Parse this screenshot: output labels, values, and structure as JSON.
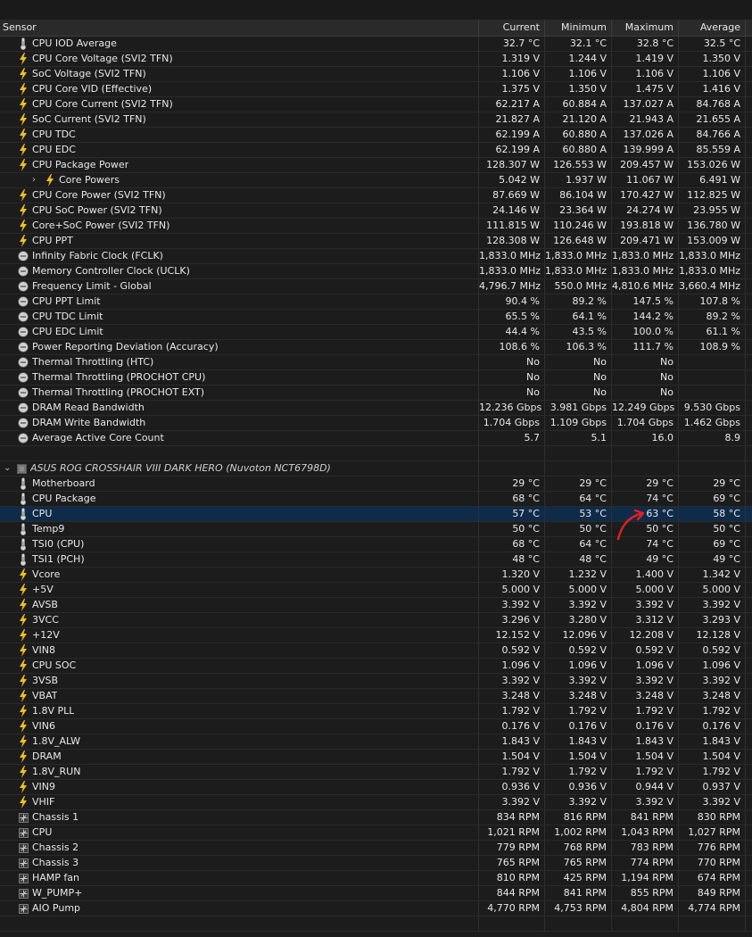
{
  "header": {
    "sensor": "Sensor",
    "current": "Current",
    "minimum": "Minimum",
    "maximum": "Maximum",
    "average": "Average"
  },
  "rows": [
    {
      "type": "sensor",
      "icon": "thermometer-icon",
      "label": "CPU IOD Average",
      "current": "32.7 °C",
      "minimum": "32.1 °C",
      "maximum": "32.8 °C",
      "average": "32.5 °C"
    },
    {
      "type": "sensor",
      "icon": "bolt-icon",
      "label": "CPU Core Voltage (SVI2 TFN)",
      "current": "1.319 V",
      "minimum": "1.244 V",
      "maximum": "1.419 V",
      "average": "1.350 V"
    },
    {
      "type": "sensor",
      "icon": "bolt-icon",
      "label": "SoC Voltage (SVI2 TFN)",
      "current": "1.106 V",
      "minimum": "1.106 V",
      "maximum": "1.106 V",
      "average": "1.106 V"
    },
    {
      "type": "sensor",
      "icon": "bolt-icon",
      "label": "CPU Core VID (Effective)",
      "current": "1.375 V",
      "minimum": "1.350 V",
      "maximum": "1.475 V",
      "average": "1.416 V"
    },
    {
      "type": "sensor",
      "icon": "bolt-icon",
      "label": "CPU Core Current (SVI2 TFN)",
      "current": "62.217 A",
      "minimum": "60.884 A",
      "maximum": "137.027 A",
      "average": "84.768 A"
    },
    {
      "type": "sensor",
      "icon": "bolt-icon",
      "label": "SoC Current (SVI2 TFN)",
      "current": "21.827 A",
      "minimum": "21.120 A",
      "maximum": "21.943 A",
      "average": "21.655 A"
    },
    {
      "type": "sensor",
      "icon": "bolt-icon",
      "label": "CPU TDC",
      "current": "62.199 A",
      "minimum": "60.880 A",
      "maximum": "137.026 A",
      "average": "84.766 A"
    },
    {
      "type": "sensor",
      "icon": "bolt-icon",
      "label": "CPU EDC",
      "current": "62.199 A",
      "minimum": "60.880 A",
      "maximum": "139.999 A",
      "average": "85.559 A"
    },
    {
      "type": "sensor",
      "icon": "bolt-icon",
      "label": "CPU Package Power",
      "current": "128.307 W",
      "minimum": "126.553 W",
      "maximum": "209.457 W",
      "average": "153.026 W"
    },
    {
      "type": "child",
      "icon": "bolt-icon",
      "label": "Core Powers",
      "current": "5.042 W",
      "minimum": "1.937 W",
      "maximum": "11.067 W",
      "average": "6.491 W"
    },
    {
      "type": "sensor",
      "icon": "bolt-icon",
      "label": "CPU Core Power (SVI2 TFN)",
      "current": "87.669 W",
      "minimum": "86.104 W",
      "maximum": "170.427 W",
      "average": "112.825 W"
    },
    {
      "type": "sensor",
      "icon": "bolt-icon",
      "label": "CPU SoC Power (SVI2 TFN)",
      "current": "24.146 W",
      "minimum": "23.364 W",
      "maximum": "24.274 W",
      "average": "23.955 W"
    },
    {
      "type": "sensor",
      "icon": "bolt-icon",
      "label": "Core+SoC Power (SVI2 TFN)",
      "current": "111.815 W",
      "minimum": "110.246 W",
      "maximum": "193.818 W",
      "average": "136.780 W"
    },
    {
      "type": "sensor",
      "icon": "bolt-icon",
      "label": "CPU PPT",
      "current": "128.308 W",
      "minimum": "126.648 W",
      "maximum": "209.471 W",
      "average": "153.009 W"
    },
    {
      "type": "sensor",
      "icon": "clock-icon",
      "label": "Infinity Fabric Clock (FCLK)",
      "current": "1,833.0 MHz",
      "minimum": "1,833.0 MHz",
      "maximum": "1,833.0 MHz",
      "average": "1,833.0 MHz"
    },
    {
      "type": "sensor",
      "icon": "clock-icon",
      "label": "Memory Controller Clock (UCLK)",
      "current": "1,833.0 MHz",
      "minimum": "1,833.0 MHz",
      "maximum": "1,833.0 MHz",
      "average": "1,833.0 MHz"
    },
    {
      "type": "sensor",
      "icon": "clock-icon",
      "label": "Frequency Limit - Global",
      "current": "4,796.7 MHz",
      "minimum": "550.0 MHz",
      "maximum": "4,810.6 MHz",
      "average": "3,660.4 MHz"
    },
    {
      "type": "sensor",
      "icon": "clock-icon",
      "label": "CPU PPT Limit",
      "current": "90.4 %",
      "minimum": "89.2 %",
      "maximum": "147.5 %",
      "average": "107.8 %"
    },
    {
      "type": "sensor",
      "icon": "clock-icon",
      "label": "CPU TDC Limit",
      "current": "65.5 %",
      "minimum": "64.1 %",
      "maximum": "144.2 %",
      "average": "89.2 %"
    },
    {
      "type": "sensor",
      "icon": "clock-icon",
      "label": "CPU EDC Limit",
      "current": "44.4 %",
      "minimum": "43.5 %",
      "maximum": "100.0 %",
      "average": "61.1 %"
    },
    {
      "type": "sensor",
      "icon": "clock-icon",
      "label": "Power Reporting Deviation (Accuracy)",
      "current": "108.6 %",
      "minimum": "106.3 %",
      "maximum": "111.7 %",
      "average": "108.9 %"
    },
    {
      "type": "sensor",
      "icon": "clock-icon",
      "label": "Thermal Throttling (HTC)",
      "current": "No",
      "minimum": "No",
      "maximum": "No",
      "average": ""
    },
    {
      "type": "sensor",
      "icon": "clock-icon",
      "label": "Thermal Throttling (PROCHOT CPU)",
      "current": "No",
      "minimum": "No",
      "maximum": "No",
      "average": ""
    },
    {
      "type": "sensor",
      "icon": "clock-icon",
      "label": "Thermal Throttling (PROCHOT EXT)",
      "current": "No",
      "minimum": "No",
      "maximum": "No",
      "average": ""
    },
    {
      "type": "sensor",
      "icon": "clock-icon",
      "label": "DRAM Read Bandwidth",
      "current": "12.236 Gbps",
      "minimum": "3.981 Gbps",
      "maximum": "12.249 Gbps",
      "average": "9.530 Gbps"
    },
    {
      "type": "sensor",
      "icon": "clock-icon",
      "label": "DRAM Write Bandwidth",
      "current": "1.704 Gbps",
      "minimum": "1.109 Gbps",
      "maximum": "1.704 Gbps",
      "average": "1.462 Gbps"
    },
    {
      "type": "sensor",
      "icon": "clock-icon",
      "label": "Average Active Core Count",
      "current": "5.7",
      "minimum": "5.1",
      "maximum": "16.0",
      "average": "8.9"
    },
    {
      "type": "blank",
      "icon": "",
      "label": "",
      "current": "",
      "minimum": "",
      "maximum": "",
      "average": ""
    },
    {
      "type": "group",
      "icon": "chip-icon",
      "label": "ASUS ROG CROSSHAIR VIII DARK HERO (Nuvoton NCT6798D)",
      "current": "",
      "minimum": "",
      "maximum": "",
      "average": ""
    },
    {
      "type": "sensor",
      "icon": "thermometer-icon",
      "label": "Motherboard",
      "current": "29 °C",
      "minimum": "29 °C",
      "maximum": "29 °C",
      "average": "29 °C"
    },
    {
      "type": "sensor",
      "icon": "thermometer-icon",
      "label": "CPU Package",
      "current": "68 °C",
      "minimum": "64 °C",
      "maximum": "74 °C",
      "average": "69 °C"
    },
    {
      "type": "sensor",
      "selected": true,
      "icon": "thermometer-icon",
      "label": "CPU",
      "current": "57 °C",
      "minimum": "53 °C",
      "maximum": "63 °C",
      "average": "58 °C"
    },
    {
      "type": "sensor",
      "icon": "thermometer-icon",
      "label": "Temp9",
      "current": "50 °C",
      "minimum": "50 °C",
      "maximum": "50 °C",
      "average": "50 °C"
    },
    {
      "type": "sensor",
      "icon": "thermometer-icon",
      "label": "TSI0 (CPU)",
      "current": "68 °C",
      "minimum": "64 °C",
      "maximum": "74 °C",
      "average": "69 °C"
    },
    {
      "type": "sensor",
      "icon": "thermometer-icon",
      "label": "TSI1 (PCH)",
      "current": "48 °C",
      "minimum": "48 °C",
      "maximum": "49 °C",
      "average": "49 °C"
    },
    {
      "type": "sensor",
      "icon": "bolt-icon",
      "label": "Vcore",
      "current": "1.320 V",
      "minimum": "1.232 V",
      "maximum": "1.400 V",
      "average": "1.342 V"
    },
    {
      "type": "sensor",
      "icon": "bolt-icon",
      "label": "+5V",
      "current": "5.000 V",
      "minimum": "5.000 V",
      "maximum": "5.000 V",
      "average": "5.000 V"
    },
    {
      "type": "sensor",
      "icon": "bolt-icon",
      "label": "AVSB",
      "current": "3.392 V",
      "minimum": "3.392 V",
      "maximum": "3.392 V",
      "average": "3.392 V"
    },
    {
      "type": "sensor",
      "icon": "bolt-icon",
      "label": "3VCC",
      "current": "3.296 V",
      "minimum": "3.280 V",
      "maximum": "3.312 V",
      "average": "3.293 V"
    },
    {
      "type": "sensor",
      "icon": "bolt-icon",
      "label": "+12V",
      "current": "12.152 V",
      "minimum": "12.096 V",
      "maximum": "12.208 V",
      "average": "12.128 V"
    },
    {
      "type": "sensor",
      "icon": "bolt-icon",
      "label": "VIN8",
      "current": "0.592 V",
      "minimum": "0.592 V",
      "maximum": "0.592 V",
      "average": "0.592 V"
    },
    {
      "type": "sensor",
      "icon": "bolt-icon",
      "label": "CPU SOC",
      "current": "1.096 V",
      "minimum": "1.096 V",
      "maximum": "1.096 V",
      "average": "1.096 V"
    },
    {
      "type": "sensor",
      "icon": "bolt-icon",
      "label": "3VSB",
      "current": "3.392 V",
      "minimum": "3.392 V",
      "maximum": "3.392 V",
      "average": "3.392 V"
    },
    {
      "type": "sensor",
      "icon": "bolt-icon",
      "label": "VBAT",
      "current": "3.248 V",
      "minimum": "3.248 V",
      "maximum": "3.248 V",
      "average": "3.248 V"
    },
    {
      "type": "sensor",
      "icon": "bolt-icon",
      "label": "1.8V PLL",
      "current": "1.792 V",
      "minimum": "1.792 V",
      "maximum": "1.792 V",
      "average": "1.792 V"
    },
    {
      "type": "sensor",
      "icon": "bolt-icon",
      "label": "VIN6",
      "current": "0.176 V",
      "minimum": "0.176 V",
      "maximum": "0.176 V",
      "average": "0.176 V"
    },
    {
      "type": "sensor",
      "icon": "bolt-icon",
      "label": "1.8V_ALW",
      "current": "1.843 V",
      "minimum": "1.843 V",
      "maximum": "1.843 V",
      "average": "1.843 V"
    },
    {
      "type": "sensor",
      "icon": "bolt-icon",
      "label": "DRAM",
      "current": "1.504 V",
      "minimum": "1.504 V",
      "maximum": "1.504 V",
      "average": "1.504 V"
    },
    {
      "type": "sensor",
      "icon": "bolt-icon",
      "label": "1.8V_RUN",
      "current": "1.792 V",
      "minimum": "1.792 V",
      "maximum": "1.792 V",
      "average": "1.792 V"
    },
    {
      "type": "sensor",
      "icon": "bolt-icon",
      "label": "VIN9",
      "current": "0.936 V",
      "minimum": "0.936 V",
      "maximum": "0.944 V",
      "average": "0.937 V"
    },
    {
      "type": "sensor",
      "icon": "bolt-icon",
      "label": "VHIF",
      "current": "3.392 V",
      "minimum": "3.392 V",
      "maximum": "3.392 V",
      "average": "3.392 V"
    },
    {
      "type": "sensor",
      "icon": "fan-icon",
      "label": "Chassis 1",
      "current": "834 RPM",
      "minimum": "816 RPM",
      "maximum": "841 RPM",
      "average": "830 RPM"
    },
    {
      "type": "sensor",
      "icon": "fan-icon",
      "label": "CPU",
      "current": "1,021 RPM",
      "minimum": "1,002 RPM",
      "maximum": "1,043 RPM",
      "average": "1,027 RPM"
    },
    {
      "type": "sensor",
      "icon": "fan-icon",
      "label": "Chassis 2",
      "current": "779 RPM",
      "minimum": "768 RPM",
      "maximum": "783 RPM",
      "average": "776 RPM"
    },
    {
      "type": "sensor",
      "icon": "fan-icon",
      "label": "Chassis 3",
      "current": "765 RPM",
      "minimum": "765 RPM",
      "maximum": "774 RPM",
      "average": "770 RPM"
    },
    {
      "type": "sensor",
      "icon": "fan-icon",
      "label": "HAMP fan",
      "current": "810 RPM",
      "minimum": "425 RPM",
      "maximum": "1,194 RPM",
      "average": "674 RPM"
    },
    {
      "type": "sensor",
      "icon": "fan-icon",
      "label": "W_PUMP+",
      "current": "844 RPM",
      "minimum": "841 RPM",
      "maximum": "855 RPM",
      "average": "849 RPM"
    },
    {
      "type": "sensor",
      "icon": "fan-icon",
      "label": "AIO Pump",
      "current": "4,770 RPM",
      "minimum": "4,753 RPM",
      "maximum": "4,804 RPM",
      "average": "4,774 RPM"
    },
    {
      "type": "blank",
      "icon": "",
      "label": "",
      "current": "",
      "minimum": "",
      "maximum": "",
      "average": ""
    }
  ],
  "colors": {
    "bolt": "#f0c020",
    "selected_row": "#0f2b4a",
    "annotation_arrow": "#e02020"
  }
}
